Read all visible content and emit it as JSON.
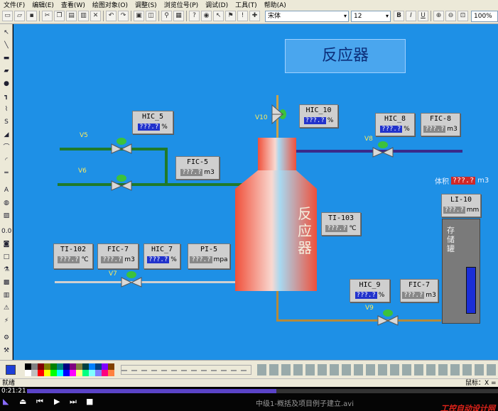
{
  "menu": [
    "文件(F)",
    "编辑(E)",
    "查看(W)",
    "绘图对象(O)",
    "调整(S)",
    "浏览位号(P)",
    "调试(D)",
    "工具(T)",
    "帮助(A)"
  ],
  "toolbar": {
    "font": "宋体",
    "size": "12",
    "bold": "B",
    "italic": "I",
    "underline": "U",
    "zoom": "100%"
  },
  "canvas": {
    "title": "反应器",
    "reactor_label": "反应器",
    "tank_label": "存储罐",
    "volume_label": "体积",
    "volume_value": "???.?",
    "volume_unit": "m3",
    "valves": {
      "v5": "V5",
      "v6": "V6",
      "v7": "V7",
      "v8": "V8",
      "v9": "V9",
      "v10": "V10"
    },
    "tags": {
      "hic5": {
        "name": "HIC_5",
        "value": "???.?",
        "unit": "%"
      },
      "fic5": {
        "name": "FIC-5",
        "value": "???.?",
        "unit": "m3"
      },
      "hic10": {
        "name": "HIC_10",
        "value": "???.?",
        "unit": "%"
      },
      "hic8": {
        "name": "HIC_8",
        "value": "???.?",
        "unit": "%"
      },
      "fic8": {
        "name": "FIC-8",
        "value": "???.?",
        "unit": "m3"
      },
      "ti103": {
        "name": "TI-103",
        "value": "???.?",
        "unit": "℃"
      },
      "li10": {
        "name": "LI-10",
        "value": "???.?",
        "unit": "mm"
      },
      "ti102": {
        "name": "TI-102",
        "value": "???.?",
        "unit": "℃"
      },
      "fic7a": {
        "name": "FIC-7",
        "value": "???.?",
        "unit": "m3"
      },
      "hic7": {
        "name": "HIC_7",
        "value": "???.?",
        "unit": "%"
      },
      "pi5": {
        "name": "PI-5",
        "value": "???.?",
        "unit": "mpa"
      },
      "hic9": {
        "name": "HIC_9",
        "value": "???.?",
        "unit": "%"
      },
      "fic7b": {
        "name": "FIC-7",
        "value": "???.?",
        "unit": "m3"
      }
    }
  },
  "status": {
    "left": "就绪",
    "right": "鼠标：X ="
  },
  "player": {
    "time": "0:21:21",
    "filename": "中级1-概括及项目例子建立.avi",
    "watermark": "工控自动设计网",
    "progress": 0.53
  },
  "colors": {
    "canvas": "#1e90e6",
    "pipe_green": "#1f7a2a",
    "pipe_purple": "#3a2a8a",
    "pipe_gray": "#d0d0d0",
    "pipe_brown": "#b58a3a",
    "reactor": "#f0503a"
  }
}
